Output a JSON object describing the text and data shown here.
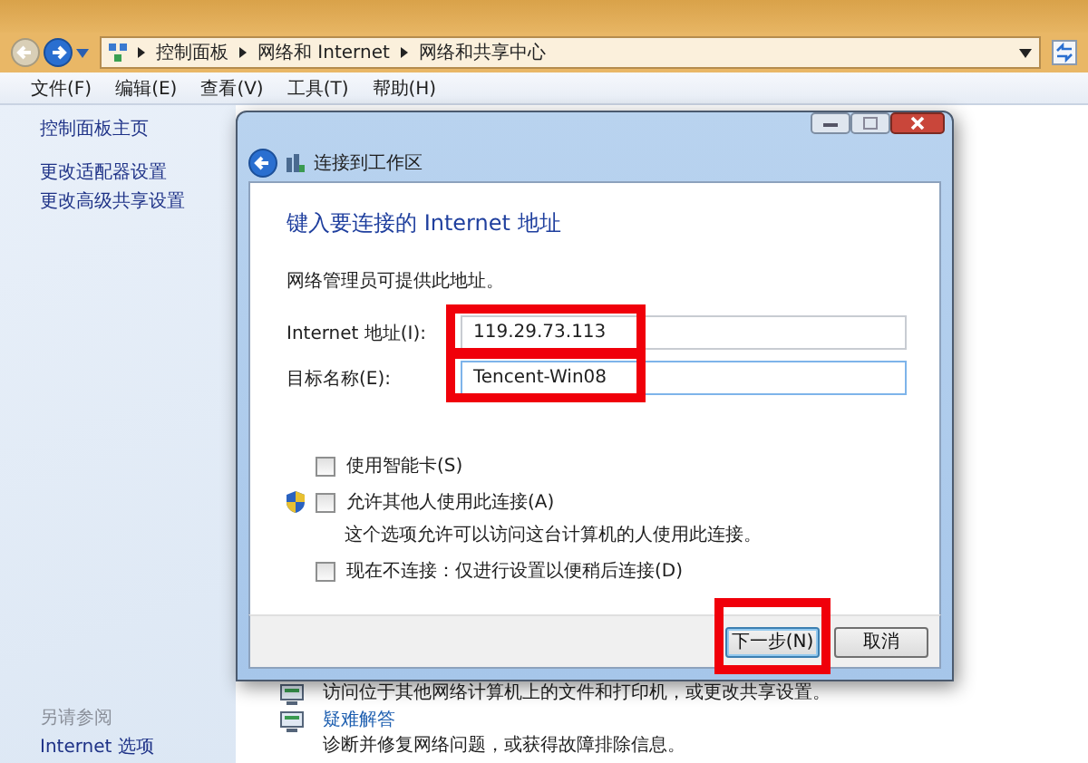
{
  "explorer": {
    "breadcrumb": [
      "控制面板",
      "网络和 Internet",
      "网络和共享中心"
    ],
    "menu": [
      "文件(F)",
      "编辑(E)",
      "查看(V)",
      "工具(T)",
      "帮助(H)"
    ],
    "sidebar": {
      "links": [
        "控制面板主页",
        "更改适配器设置",
        "更改高级共享设置"
      ],
      "see_also_title": "另请参阅",
      "see_also": [
        "Internet 选项"
      ]
    },
    "tasks": [
      {
        "description": "访问位于其他网络计算机上的文件和打印机，或更改共享设置。"
      },
      {
        "title": "疑难解答",
        "description": "诊断并修复网络问题，或获得故障排除信息。"
      }
    ]
  },
  "dialog": {
    "title": "连接到工作区",
    "heading": "键入要连接的 Internet 地址",
    "intro": "网络管理员可提供此地址。",
    "fields": [
      {
        "label": "Internet 地址(I):",
        "value": "119.29.73.113",
        "focused": false,
        "highlighted": true
      },
      {
        "label": "目标名称(E):",
        "value": "Tencent-Win08",
        "focused": true,
        "highlighted": true
      }
    ],
    "options": [
      {
        "label": "使用智能卡(S)",
        "checked": false,
        "shield": false
      },
      {
        "label": "允许其他人使用此连接(A)",
        "checked": false,
        "shield": true,
        "note": "这个选项允许可以访问这台计算机的人使用此连接。"
      },
      {
        "label": "现在不连接：仅进行设置以便稍后连接(D)",
        "checked": false,
        "shield": false
      }
    ],
    "buttons": [
      {
        "label": "下一步(N)",
        "default": true,
        "highlighted": true
      },
      {
        "label": "取消",
        "default": false,
        "highlighted": false
      }
    ]
  }
}
